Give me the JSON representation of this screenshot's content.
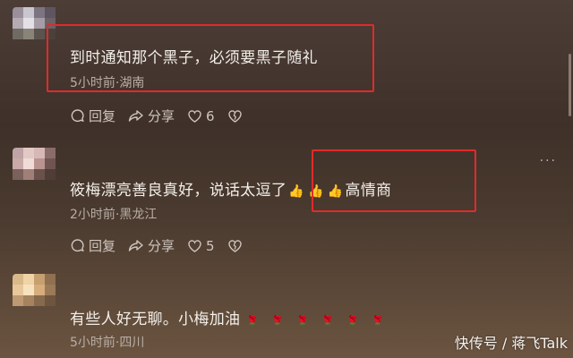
{
  "comments": [
    {
      "text": "到时通知那个黑子，必须要黑子随礼",
      "meta": "5小时前·湖南",
      "reply_label": "回复",
      "share_label": "分享",
      "likes": "6"
    },
    {
      "text_prefix": "筱梅漂亮善良真好，说话太逗了",
      "emoji": "👍",
      "text_suffix": "高情商",
      "meta": "2小时前·黑龙江",
      "reply_label": "回复",
      "share_label": "分享",
      "likes": "5",
      "more": "···"
    },
    {
      "text_prefix": "有些人好无聊。小梅加油",
      "emoji": "🌹",
      "meta": "5小时前·四川"
    }
  ],
  "watermark": "快传号 / 蒋飞Talk",
  "colors": {
    "highlight": "#e02b2b",
    "text": "#f3efe9",
    "meta": "#b9aea6"
  }
}
